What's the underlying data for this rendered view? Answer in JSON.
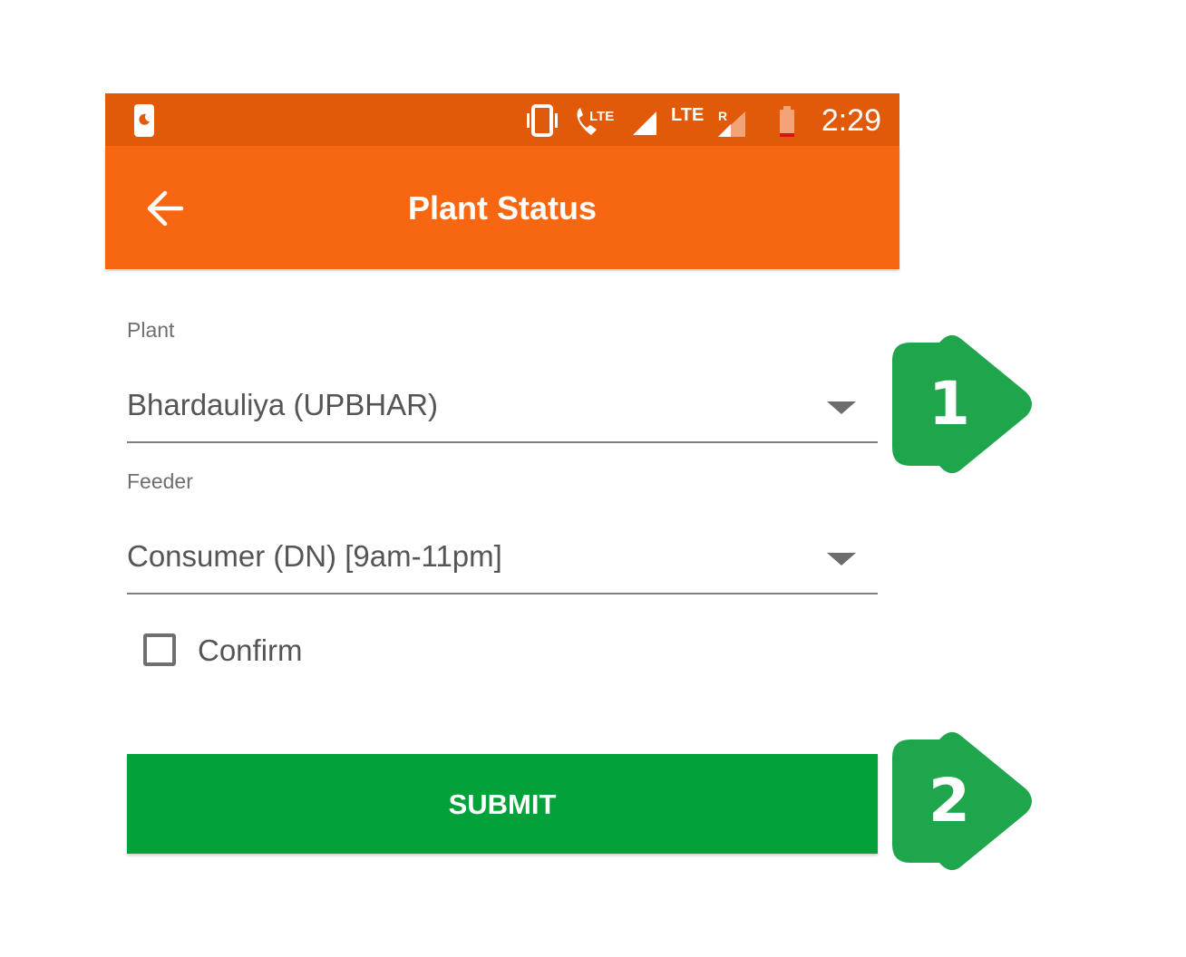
{
  "statusbar": {
    "time": "2:29",
    "icons": [
      "notification-icon",
      "vibrate-icon",
      "volte-call-icon",
      "signal-icon",
      "signal-lte-roaming-icon",
      "battery-low-icon"
    ],
    "lte_label_1": "LTE",
    "lte_label_2": "LTE",
    "roaming_label": "R"
  },
  "appbar": {
    "title": "Plant Status",
    "back_icon": "arrow-left-icon"
  },
  "form": {
    "plant_label": "Plant",
    "plant_value": "Bhardauliya (UPBHAR)",
    "feeder_label": "Feeder",
    "feeder_value": "Consumer (DN) [9am-11pm]",
    "confirm_label": "Confirm",
    "confirm_checked": false,
    "submit_label": "SUBMIT"
  },
  "callouts": [
    {
      "number": "1"
    },
    {
      "number": "2"
    }
  ],
  "colors": {
    "statusbar": "#e05a09",
    "appbar": "#f76711",
    "submit": "#03a13a",
    "callout": "#1fa64c"
  }
}
